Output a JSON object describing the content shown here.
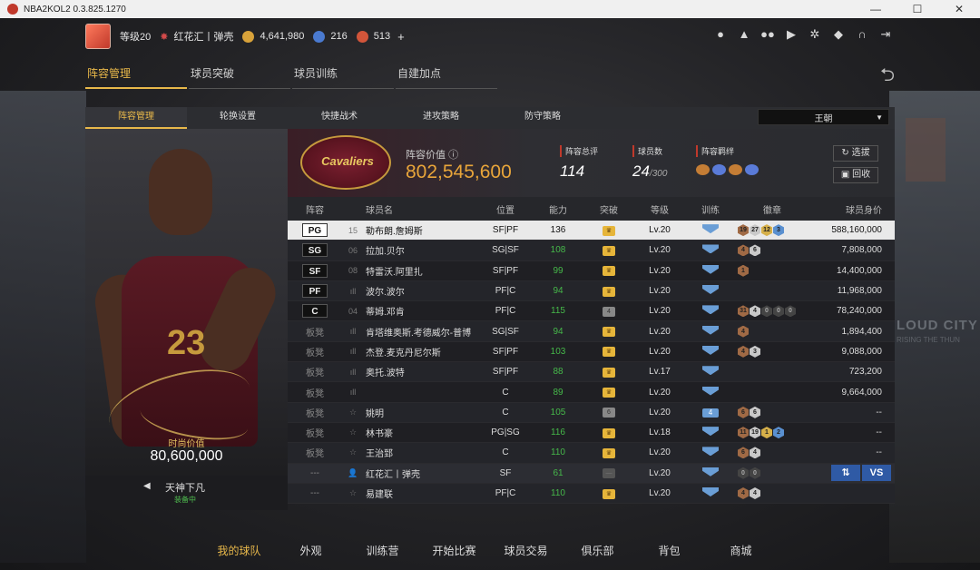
{
  "window": {
    "title": "NBA2KOL2 0.3.825.1270",
    "controls": [
      "—",
      "☐",
      "✕"
    ]
  },
  "user": {
    "level": "等级20",
    "team_name": "红花汇丨弹壳",
    "gold": "4,641,980",
    "stars": "216",
    "tickets": "513",
    "plus": "+"
  },
  "top_icons": [
    "user-icon",
    "bell-icon",
    "friends-icon",
    "video-icon",
    "gear-icon",
    "shield-icon",
    "headset-icon",
    "exit-icon"
  ],
  "main_tabs": [
    "阵容管理",
    "球员突破",
    "球员训练",
    "自建加点"
  ],
  "sub_tabs": [
    "阵容管理",
    "轮换设置",
    "快捷战术",
    "进攻策略",
    "防守策略"
  ],
  "dynasty_select": "王朝",
  "card": {
    "value_label": "时尚价值",
    "value": "80,600,000",
    "skill_name": "天神下凡",
    "skill_status": "装备中"
  },
  "team": {
    "logo_text": "Cavaliers",
    "value_label": "阵容价值",
    "value": "802,545,600",
    "rating_label": "阵容总评",
    "rating": "114",
    "count_label": "球员数",
    "count": "24",
    "count_max": "/300",
    "bond_label": "阵容羁绊",
    "select_btn": "选拔",
    "recycle_btn": "回收"
  },
  "table": {
    "headers": [
      "阵容",
      "球员名",
      "位置",
      "能力",
      "突破",
      "等级",
      "训练",
      "徽章",
      "球员身价"
    ],
    "rows": [
      {
        "pos": "PG",
        "num": "15",
        "name": "勒布朗.詹姆斯",
        "position": "SF|PF",
        "ability": "136",
        "lv": "Lv.20",
        "badges": [
          [
            "br",
            "19"
          ],
          [
            "sv",
            "27"
          ],
          [
            "gd",
            "12"
          ],
          [
            "bl",
            "3"
          ]
        ],
        "value": "588,160,000",
        "selected": true,
        "ability_green": false
      },
      {
        "pos": "SG",
        "num": "06",
        "name": "拉加.贝尔",
        "position": "SG|SF",
        "ability": "108",
        "lv": "Lv.20",
        "badges": [
          [
            "br",
            "4"
          ],
          [
            "sv",
            "6"
          ]
        ],
        "value": "7,808,000"
      },
      {
        "pos": "SF",
        "num": "08",
        "name": "特雷沃.阿里扎",
        "position": "SF|PF",
        "ability": "99",
        "lv": "Lv.20",
        "badges": [
          [
            "br",
            "1"
          ]
        ],
        "value": "14,400,000"
      },
      {
        "pos": "PF",
        "num": "ıll",
        "name": "波尔.波尔",
        "position": "PF|C",
        "ability": "94",
        "lv": "Lv.20",
        "badges": [],
        "value": "11,968,000"
      },
      {
        "pos": "C",
        "num": "04",
        "name": "蒂姆.邓肯",
        "position": "PF|C",
        "ability": "115",
        "lv": "Lv.20",
        "breakthrough": "4",
        "badges": [
          [
            "br",
            "31"
          ],
          [
            "sv",
            "4"
          ],
          [
            "dk",
            "0"
          ],
          [
            "dk",
            "0"
          ],
          [
            "dk",
            "0"
          ]
        ],
        "value": "78,240,000"
      },
      {
        "pos": "板凳",
        "num": "ıll",
        "name": "肯塔维奥斯.考德威尔-普博",
        "position": "SG|SF",
        "ability": "94",
        "lv": "Lv.20",
        "badges": [
          [
            "br",
            "4"
          ]
        ],
        "value": "1,894,400"
      },
      {
        "pos": "板凳",
        "num": "ıll",
        "name": "杰登.麦克丹尼尔斯",
        "position": "SF|PF",
        "ability": "103",
        "lv": "Lv.20",
        "badges": [
          [
            "br",
            "4"
          ],
          [
            "sv",
            "3"
          ]
        ],
        "value": "9,088,000"
      },
      {
        "pos": "板凳",
        "num": "ıll",
        "name": "奥托.波特",
        "position": "SF|PF",
        "ability": "88",
        "lv": "Lv.17",
        "badges": [],
        "value": "723,200"
      },
      {
        "pos": "板凳",
        "num": "ıll",
        "name": "",
        "position": "C",
        "ability": "89",
        "lv": "Lv.20",
        "badges": [],
        "value": "9,664,000"
      },
      {
        "pos": "板凳",
        "num": "☆",
        "name": "姚明",
        "position": "C",
        "ability": "105",
        "lv": "Lv.20",
        "breakthrough": "6",
        "train": "4",
        "badges": [
          [
            "br",
            "6"
          ],
          [
            "sv",
            "6"
          ]
        ],
        "value": "--"
      },
      {
        "pos": "板凳",
        "num": "☆",
        "name": "林书豪",
        "position": "PG|SG",
        "ability": "116",
        "lv": "Lv.18",
        "badges": [
          [
            "br",
            "11"
          ],
          [
            "sv",
            "19"
          ],
          [
            "gd",
            "1"
          ],
          [
            "bl",
            "2"
          ]
        ],
        "value": "--"
      },
      {
        "pos": "板凳",
        "num": "☆",
        "name": "王治郅",
        "position": "C",
        "ability": "110",
        "lv": "Lv.20",
        "badges": [
          [
            "br",
            "6"
          ],
          [
            "sv",
            "4"
          ]
        ],
        "value": "--"
      },
      {
        "pos": "---",
        "num": "👤",
        "name": "红花汇丨弹壳",
        "position": "SF",
        "ability": "61",
        "lv": "Lv.20",
        "badges": [
          [
            "dk",
            "0"
          ],
          [
            "dk",
            "0"
          ]
        ],
        "value": "",
        "self": true,
        "no_break": true
      },
      {
        "pos": "---",
        "num": "☆",
        "name": "易建联",
        "position": "PF|C",
        "ability": "110",
        "lv": "Lv.20",
        "badges": [
          [
            "br",
            "4"
          ],
          [
            "sv",
            "4"
          ]
        ],
        "value": ""
      }
    ],
    "swap_label": "⇅",
    "vs_label": "VS"
  },
  "bottom_nav": [
    "我的球队",
    "外观",
    "训练营",
    "开始比赛",
    "球员交易",
    "俱乐部",
    "背包",
    "商城"
  ],
  "colors": {
    "accent": "#e8b84a",
    "value_orange": "#e8a53a",
    "ability_green": "#46b94a"
  }
}
